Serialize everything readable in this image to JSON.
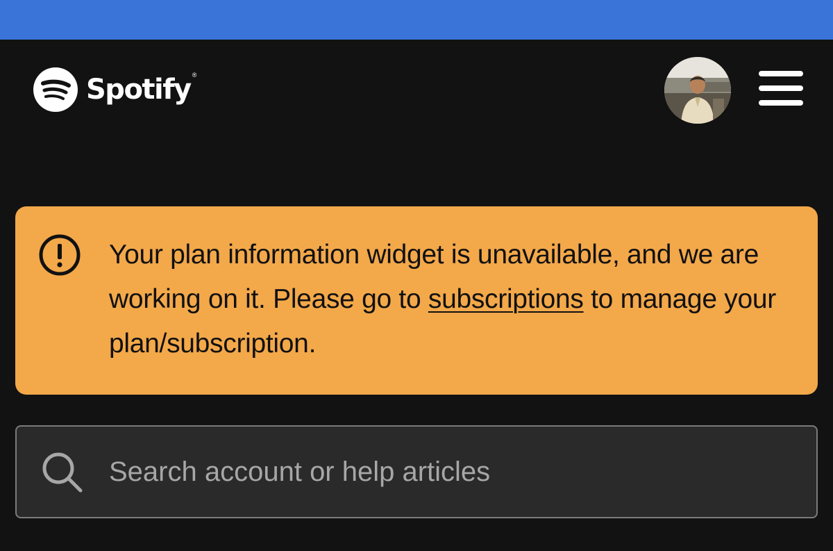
{
  "header": {
    "logo_text": "Spotify",
    "logo_registered": "®",
    "avatar_icon": "user-avatar",
    "menu_icon": "hamburger-menu-icon"
  },
  "alert": {
    "icon": "exclamation-circle-icon",
    "text_before_link": "Your plan information widget is unavailable, and we are working on it. Please go to ",
    "link_text": "subscriptions",
    "text_after_link": " to manage your plan/subscription.",
    "background_color": "#f3a84a"
  },
  "search": {
    "icon": "search-icon",
    "placeholder": "Search account or help articles",
    "value": ""
  },
  "colors": {
    "top_bar": "#3a74d9",
    "page_background": "#121212",
    "search_background": "#2a2a2a"
  }
}
